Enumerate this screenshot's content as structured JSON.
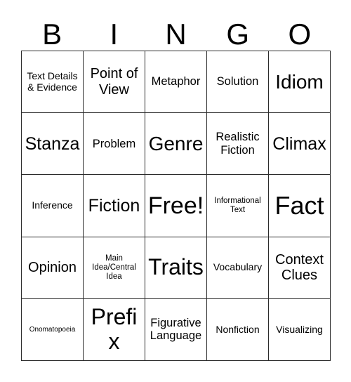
{
  "card": {
    "title": "BINGO",
    "header_letters": [
      "B",
      "I",
      "N",
      "G",
      "O"
    ],
    "free_space_label": "Free!",
    "colors": {
      "background": "#ffffff",
      "border": "#2b2b2b",
      "text": "#000000"
    },
    "grid": {
      "columns": 5,
      "rows": 5,
      "cells": [
        [
          {
            "label": "Text Details & Evidence",
            "size": "md"
          },
          {
            "label": "Point of View",
            "size": "xl"
          },
          {
            "label": "Metaphor",
            "size": "lg"
          },
          {
            "label": "Solution",
            "size": "lg"
          },
          {
            "label": "Idiom",
            "size": "3xl"
          }
        ],
        [
          {
            "label": "Stanza",
            "size": "2xl"
          },
          {
            "label": "Problem",
            "size": "lg"
          },
          {
            "label": "Genre",
            "size": "3xl"
          },
          {
            "label": "Realistic Fiction",
            "size": "lg"
          },
          {
            "label": "Climax",
            "size": "2xl"
          }
        ],
        [
          {
            "label": "Inference",
            "size": "md"
          },
          {
            "label": "Fiction",
            "size": "2xl"
          },
          {
            "label": "Free!",
            "size": "5xl"
          },
          {
            "label": "Informational Text",
            "size": "sm"
          },
          {
            "label": "Fact",
            "size": "6xl"
          }
        ],
        [
          {
            "label": "Opinion",
            "size": "xl"
          },
          {
            "label": "Main Idea/Central Idea",
            "size": "sm"
          },
          {
            "label": "Traits",
            "size": "4xl"
          },
          {
            "label": "Vocabulary",
            "size": "md"
          },
          {
            "label": "Context Clues",
            "size": "xl"
          }
        ],
        [
          {
            "label": "Onomatopoeia",
            "size": "xs"
          },
          {
            "label": "Prefix",
            "size": "4xl"
          },
          {
            "label": "Figurative Language",
            "size": "lg"
          },
          {
            "label": "Nonfiction",
            "size": "md"
          },
          {
            "label": "Visualizing",
            "size": "md"
          }
        ]
      ]
    }
  }
}
